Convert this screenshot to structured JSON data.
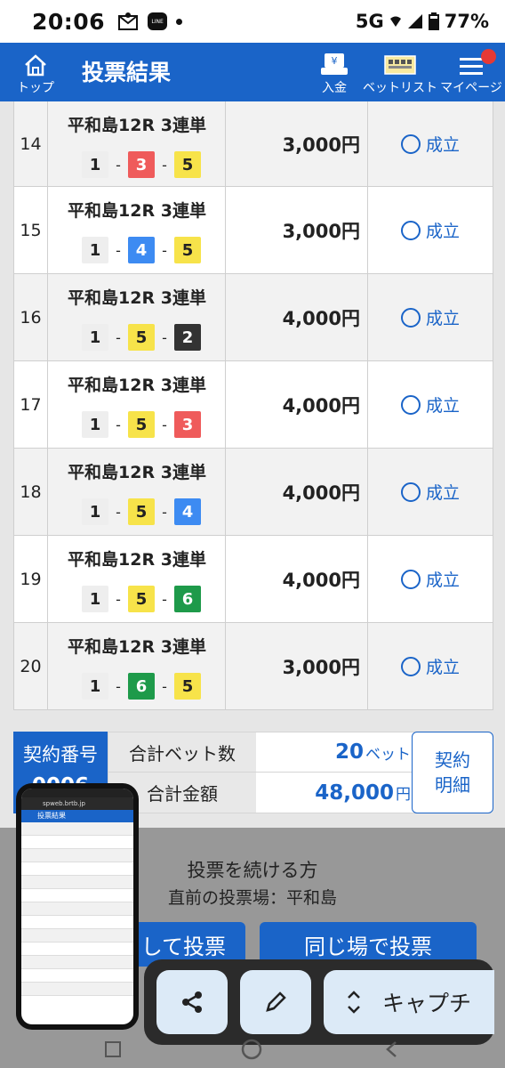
{
  "status_bar": {
    "time": "20:06",
    "network": "5G",
    "battery": "77%"
  },
  "header": {
    "title": "投票結果",
    "home": "トップ",
    "deposit": "入金",
    "betlist": "ベットリスト",
    "mypage": "マイページ"
  },
  "rows": [
    {
      "no": "14",
      "race": "平和島12R 3連単",
      "combo": [
        "1",
        "3",
        "5"
      ],
      "amount": "3,000円",
      "status": "成立"
    },
    {
      "no": "15",
      "race": "平和島12R 3連単",
      "combo": [
        "1",
        "4",
        "5"
      ],
      "amount": "3,000円",
      "status": "成立"
    },
    {
      "no": "16",
      "race": "平和島12R 3連単",
      "combo": [
        "1",
        "5",
        "2"
      ],
      "amount": "4,000円",
      "status": "成立"
    },
    {
      "no": "17",
      "race": "平和島12R 3連単",
      "combo": [
        "1",
        "5",
        "3"
      ],
      "amount": "4,000円",
      "status": "成立"
    },
    {
      "no": "18",
      "race": "平和島12R 3連単",
      "combo": [
        "1",
        "5",
        "4"
      ],
      "amount": "4,000円",
      "status": "成立"
    },
    {
      "no": "19",
      "race": "平和島12R 3連単",
      "combo": [
        "1",
        "5",
        "6"
      ],
      "amount": "4,000円",
      "status": "成立"
    },
    {
      "no": "20",
      "race": "平和島12R 3連単",
      "combo": [
        "1",
        "6",
        "5"
      ],
      "amount": "3,000円",
      "status": "成立"
    }
  ],
  "boat_colors": {
    "1": {
      "bg": "#eeeeee",
      "fg": "#222222"
    },
    "2": {
      "bg": "#333333",
      "fg": "#ffffff"
    },
    "3": {
      "bg": "#ef5b5b",
      "fg": "#ffffff"
    },
    "4": {
      "bg": "#3d8bf2",
      "fg": "#ffffff"
    },
    "5": {
      "bg": "#f7e34a",
      "fg": "#222222"
    },
    "6": {
      "bg": "#1e9a4a",
      "fg": "#ffffff"
    }
  },
  "summary": {
    "contract_label": "契約番号",
    "contract_no": "0006",
    "total_bets_label": "合計ベット数",
    "total_bets": "20",
    "total_bets_unit": "ベット",
    "total_amount_label": "合計金額",
    "total_amount": "48,000",
    "total_amount_unit": "円",
    "detail_line1": "契約",
    "detail_line2": "明細"
  },
  "continue": {
    "title": "投票を続ける方",
    "subtitle": "直前の投票場：平和島",
    "btn_left": "して投票",
    "btn_right": "同じ場で投票"
  },
  "capture_toolbar": {
    "capture": "キャプチ"
  },
  "thumbnail": {
    "url": "spweb.brtb.jp",
    "title": "投票結果"
  }
}
